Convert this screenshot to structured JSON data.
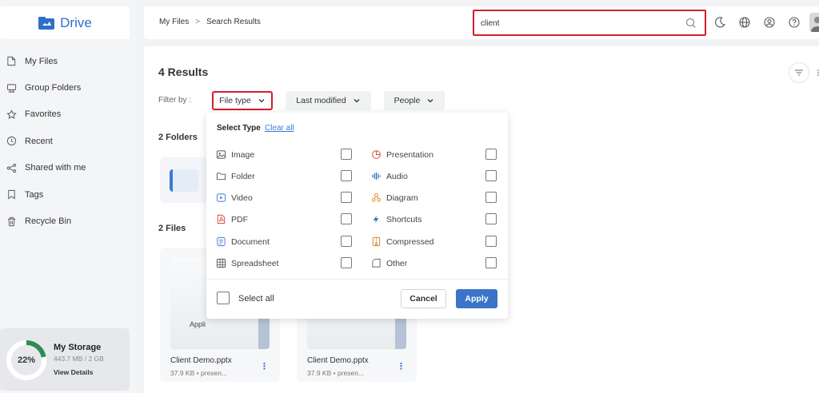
{
  "app": {
    "name": "Drive"
  },
  "sidebar": {
    "items": [
      {
        "label": "My Files",
        "icon": "file-icon"
      },
      {
        "label": "Group Folders",
        "icon": "group-folder-icon"
      },
      {
        "label": "Favorites",
        "icon": "star-icon"
      },
      {
        "label": "Recent",
        "icon": "clock-icon"
      },
      {
        "label": "Shared with me",
        "icon": "share-icon"
      },
      {
        "label": "Tags",
        "icon": "tag-icon"
      },
      {
        "label": "Recycle Bin",
        "icon": "trash-icon"
      }
    ],
    "storage": {
      "percent_label": "22%",
      "percent": 22,
      "title": "My Storage",
      "usage": "443.7 MB / 2 GB",
      "link": "View Details"
    }
  },
  "header": {
    "breadcrumb": [
      "My Files",
      "Search Results"
    ],
    "breadcrumb_sep": ">",
    "search_value": "client",
    "icons": [
      "moon-icon",
      "globe-icon",
      "contact-icon",
      "help-icon"
    ]
  },
  "main": {
    "results_title": "4 Results",
    "filter_label": "Filter by :",
    "filters": [
      "File type",
      "Last modified",
      "People"
    ],
    "folders_label": "2 Folders",
    "files_label": "2 Files",
    "files": [
      {
        "name": "Client Demo.pptx",
        "meta": "37.9 KB • presen...",
        "thumb_text": "Appli"
      },
      {
        "name": "Client Demo.pptx",
        "meta": "37.9 KB • presen..."
      }
    ]
  },
  "dropdown": {
    "title": "Select Type",
    "clear": "Clear all",
    "types_left": [
      {
        "label": "Image",
        "icon": "image-icon"
      },
      {
        "label": "Folder",
        "icon": "folder-icon"
      },
      {
        "label": "Video",
        "icon": "video-icon"
      },
      {
        "label": "PDF",
        "icon": "pdf-icon"
      },
      {
        "label": "Document",
        "icon": "document-icon"
      },
      {
        "label": "Spreadsheet",
        "icon": "spreadsheet-icon"
      }
    ],
    "types_right": [
      {
        "label": "Presentation",
        "icon": "presentation-icon"
      },
      {
        "label": "Audio",
        "icon": "audio-icon"
      },
      {
        "label": "Diagram",
        "icon": "diagram-icon"
      },
      {
        "label": "Shortcuts",
        "icon": "shortcut-icon"
      },
      {
        "label": "Compressed",
        "icon": "compressed-icon"
      },
      {
        "label": "Other",
        "icon": "other-icon"
      }
    ],
    "select_all": "Select all",
    "cancel": "Cancel",
    "apply": "Apply"
  },
  "colors": {
    "accent": "#3b74c9",
    "highlight": "#d0202b",
    "storage_ring": "#2e8b57"
  }
}
